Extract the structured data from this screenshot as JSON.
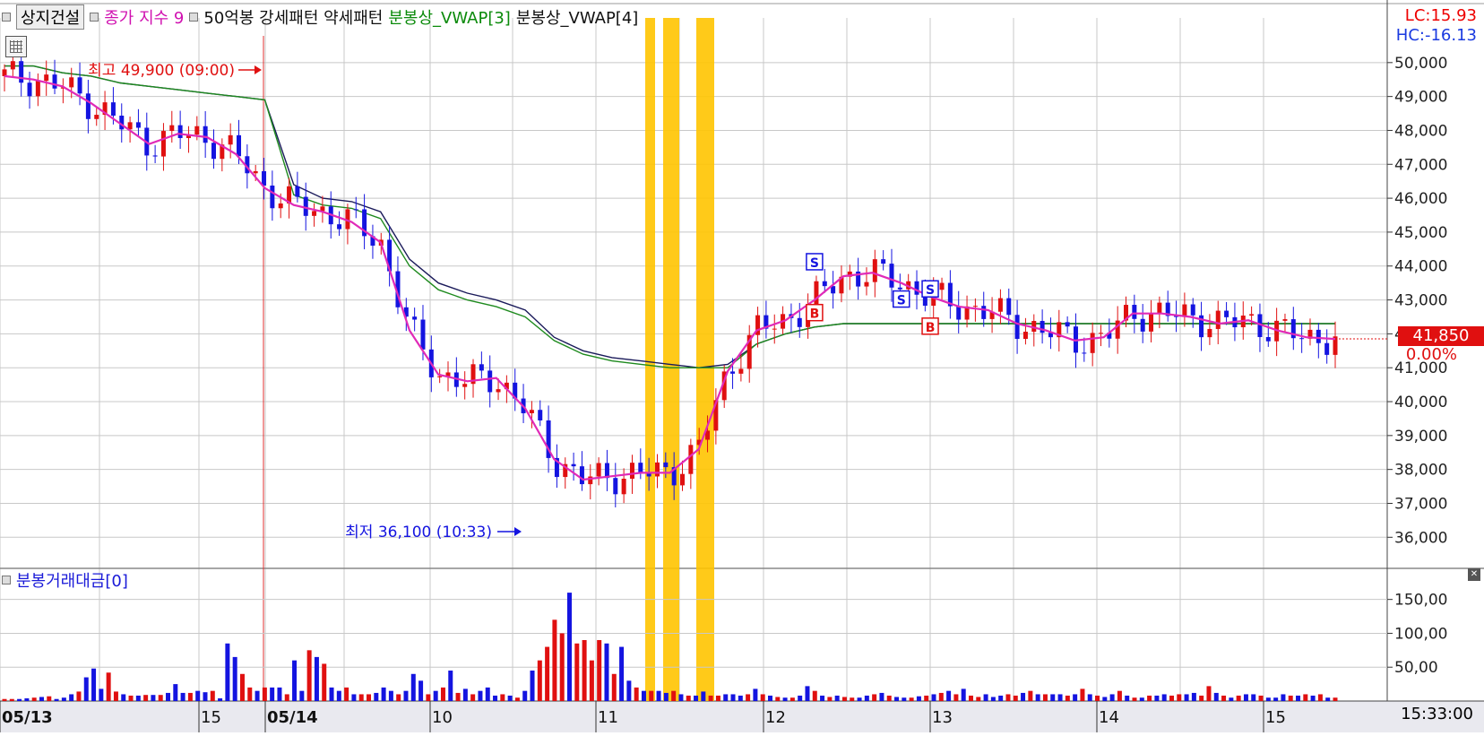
{
  "header": {
    "stock_name": "상지건설",
    "close_index_label": "종가 지수 9",
    "volume_label": "50억봉 강세패턴 약세패턴",
    "vwap3_label": "분봉상_VWAP[3]",
    "vwap4_label": "분봉상_VWAP[4]"
  },
  "right_panel": {
    "lc": "LC:15.93",
    "hc": "HC:-16.13",
    "current_price": "41,850",
    "change_pct": "0.00%",
    "time": "15:33:00"
  },
  "annotations": {
    "high": "최고 49,900 (09:00)",
    "low": "최저 36,100 (10:33)"
  },
  "volume_panel": {
    "title": "분봉거래대금[0]"
  },
  "colors": {
    "up": "#e01010",
    "down": "#1414e0",
    "ma": "#e02ab8",
    "vwap3": "#1e8a1e",
    "vwap4": "#1a1a5a",
    "highlight": "#ffc400",
    "grid": "#c8c8c8"
  },
  "chart_data": [
    {
      "type": "line",
      "title": "",
      "y_ticks": [
        "50,000",
        "49,000",
        "48,000",
        "47,000",
        "46,000",
        "45,000",
        "44,000",
        "43,000",
        "42,000",
        "41,000",
        "40,000",
        "39,000",
        "38,000",
        "37,000",
        "36,000"
      ],
      "x_ticks": [
        "05/13",
        "15",
        "05/14",
        "10",
        "11",
        "12",
        "13",
        "14",
        "15"
      ],
      "series": [
        {
          "name": "종가 지수 9",
          "values": [
            49600,
            49500,
            49300,
            48800,
            48200,
            47600,
            47900,
            47800,
            47300,
            46300,
            45800,
            45600,
            45300,
            44700,
            42100,
            40800,
            40600,
            40700,
            39800,
            38300,
            37700,
            37800,
            37900,
            37900,
            38600,
            40900,
            42100,
            42400,
            43000,
            43700,
            43800,
            43500,
            43100,
            42800,
            42700,
            42300,
            42100,
            41800,
            41900,
            42600,
            42600,
            42500,
            42300,
            42400,
            42100,
            41900,
            41850
          ]
        },
        {
          "name": "분봉상_VWAP[3]",
          "values": [
            49900,
            49900,
            49700,
            49600,
            49400,
            49300,
            49200,
            49100,
            49000,
            48900,
            46100,
            45800,
            45700,
            45400,
            44000,
            43300,
            43000,
            42800,
            42500,
            41800,
            41400,
            41200,
            41100,
            41000,
            41000,
            41000,
            41700,
            42000,
            42200,
            42300,
            42300,
            42300,
            42300,
            42300,
            42300,
            42300,
            42300,
            42300,
            42300,
            42300,
            42300,
            42300,
            42300,
            42300,
            42300,
            42300,
            42300
          ]
        },
        {
          "name": "분봉상_VWAP[4]",
          "values": [
            49900,
            49900,
            49700,
            49600,
            49400,
            49300,
            49200,
            49100,
            49000,
            48900,
            46400,
            46000,
            45900,
            45600,
            44200,
            43500,
            43200,
            43000,
            42700,
            41900,
            41500,
            41300,
            41200,
            41100,
            41000,
            41100,
            41700,
            42000,
            42200,
            42300,
            42300,
            42300,
            42300,
            42300,
            42300,
            42300,
            42300,
            42300,
            42300,
            42300,
            42300,
            42300,
            42300,
            42300,
            42300,
            42300,
            42300
          ]
        }
      ],
      "ylim": [
        35400,
        51000
      ],
      "markers": [
        {
          "label": "S",
          "type": "sell",
          "x_index": 28,
          "price": 44100
        },
        {
          "label": "B",
          "type": "buy",
          "x_index": 28,
          "price": 42600
        },
        {
          "label": "S",
          "type": "sell",
          "x_index": 31,
          "price": 43000
        },
        {
          "label": "S",
          "type": "sell",
          "x_index": 32,
          "price": 43300
        },
        {
          "label": "B",
          "type": "buy",
          "x_index": 32,
          "price": 42200
        }
      ]
    },
    {
      "type": "bar",
      "title": "분봉거래대금[0]",
      "y_ticks": [
        "150,00",
        "100,00",
        "50,00"
      ],
      "ylim": [
        0,
        180
      ],
      "values": [
        3,
        3,
        3,
        4,
        5,
        6,
        7,
        3,
        5,
        10,
        14,
        35,
        48,
        18,
        42,
        14,
        10,
        8,
        8,
        9,
        9,
        9,
        12,
        25,
        12,
        12,
        15,
        13,
        15,
        4,
        85,
        65,
        40,
        20,
        15,
        20,
        20,
        20,
        10,
        60,
        15,
        75,
        65,
        55,
        20,
        15,
        20,
        10,
        10,
        10,
        12,
        20,
        15,
        10,
        15,
        40,
        30,
        10,
        15,
        20,
        45,
        12,
        18,
        10,
        15,
        20,
        8,
        10,
        8,
        5,
        15,
        45,
        60,
        80,
        120,
        100,
        160,
        85,
        90,
        60,
        90,
        85,
        40,
        80,
        30,
        20,
        15,
        15,
        15,
        12,
        15,
        10,
        8,
        8,
        14,
        8,
        8,
        10,
        10,
        8,
        10,
        18,
        10,
        8,
        6,
        5,
        5,
        8,
        22,
        15,
        8,
        6,
        8,
        6,
        5,
        5,
        8,
        10,
        12,
        8,
        6,
        5,
        5,
        7,
        8,
        10,
        12,
        15,
        10,
        18,
        8,
        6,
        10,
        6,
        8,
        10,
        8,
        12,
        15,
        10,
        10,
        10,
        10,
        8,
        10,
        18,
        10,
        8,
        6,
        10,
        15,
        8,
        5,
        5,
        8,
        8,
        10,
        8,
        10,
        10,
        12,
        8,
        22,
        12,
        8,
        5,
        8,
        10,
        10,
        8,
        5,
        5,
        10,
        8,
        8,
        10,
        8,
        10,
        5,
        5
      ],
      "up_flags": [
        1,
        1,
        0,
        0,
        1,
        0,
        1,
        0,
        0,
        0,
        1,
        0,
        0,
        0,
        1,
        1,
        0,
        1,
        0,
        1,
        0,
        1,
        0,
        0,
        0,
        1,
        0,
        0,
        1,
        0,
        0,
        0,
        1,
        1,
        0,
        1,
        0,
        0,
        1,
        0,
        0,
        1,
        0,
        1,
        0,
        0,
        1,
        0,
        1,
        1,
        0,
        0,
        0,
        1,
        0,
        0,
        0,
        1,
        0,
        1,
        0,
        1,
        0,
        1,
        0,
        0,
        0,
        1,
        0,
        1,
        0,
        0,
        1,
        1,
        1,
        1,
        0,
        1,
        1,
        1,
        1,
        0,
        1,
        0,
        0,
        1,
        0,
        1,
        0,
        0,
        1,
        0,
        1,
        0,
        0,
        1,
        1,
        0,
        0,
        0,
        1,
        0,
        1,
        0,
        1,
        0,
        1,
        0,
        0,
        1,
        0,
        1,
        0,
        1,
        1,
        0,
        0,
        1,
        0,
        1,
        0,
        0,
        1,
        0,
        1,
        0,
        1,
        0,
        1,
        0,
        1,
        1,
        0,
        0,
        0,
        1,
        1,
        0,
        1,
        0,
        1,
        0,
        0,
        1,
        0,
        1,
        0,
        1,
        0,
        0,
        1,
        0,
        1,
        0,
        1,
        0,
        0,
        1,
        1,
        0,
        0,
        1,
        1,
        0,
        1,
        0,
        1,
        0,
        0,
        1,
        0,
        0,
        0,
        1,
        0,
        1,
        0,
        1,
        0,
        1,
        0,
        1,
        0,
        1,
        0
      ]
    }
  ]
}
